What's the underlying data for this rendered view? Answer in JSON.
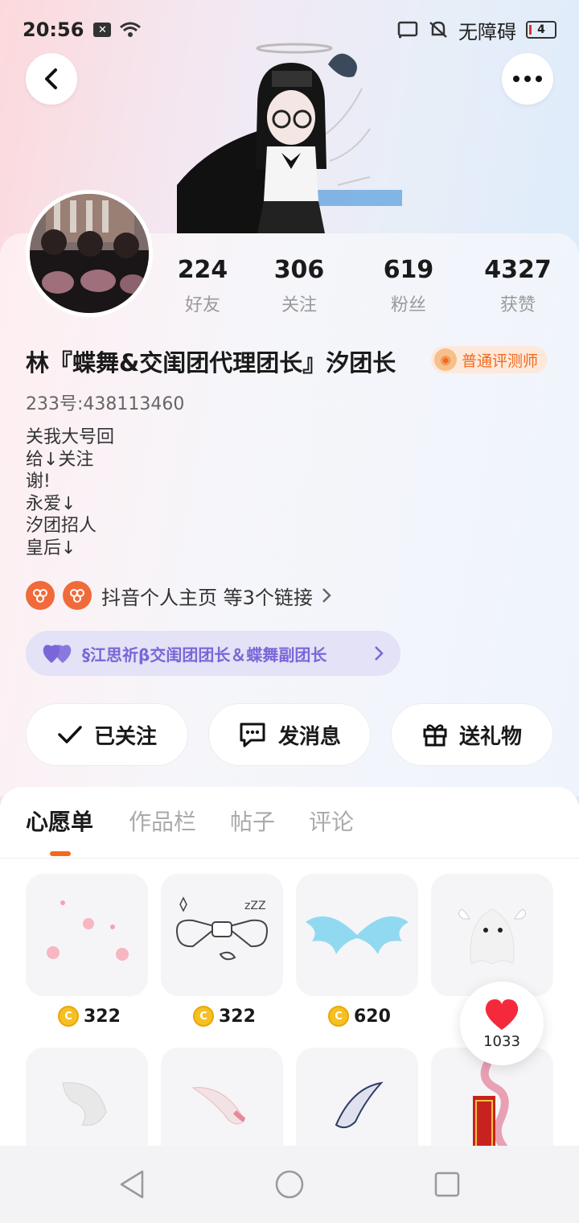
{
  "status_bar": {
    "time": "20:56",
    "accessibility": "无障碍",
    "battery": "4"
  },
  "profile": {
    "nickname": "林『蝶舞&交闺团代理团长』汐团长",
    "badge": "普通评测师",
    "uid": "233号:438113460",
    "bio_lines": [
      "关我大号回",
      "给↓关注",
      "谢!",
      "永爱↓",
      "汐团招人",
      "皇后↓"
    ],
    "links_text": "抖音个人主页 等3个链接",
    "group_text": "§江思祈β交闺团团长＆蝶舞副团长"
  },
  "stats": [
    {
      "value": "224",
      "label": "好友"
    },
    {
      "value": "306",
      "label": "关注"
    },
    {
      "value": "619",
      "label": "粉丝"
    },
    {
      "value": "4327",
      "label": "获赞"
    }
  ],
  "actions": {
    "follow": "已关注",
    "message": "发消息",
    "gift": "送礼物"
  },
  "tabs": [
    "心愿单",
    "作品栏",
    "帖子",
    "评论"
  ],
  "active_tab": "心愿单",
  "wishlist": [
    {
      "price": "322",
      "icon": "pink-sparkles-icon"
    },
    {
      "price": "322",
      "icon": "sleep-bow-icon"
    },
    {
      "price": "620",
      "icon": "blue-wings-icon"
    },
    {
      "price": "",
      "icon": "ghost-icon"
    },
    {
      "price": "",
      "icon": "white-tail-icon"
    },
    {
      "price": "",
      "icon": "pink-tail-icon"
    },
    {
      "price": "",
      "icon": "navy-tail-icon"
    },
    {
      "price": "",
      "icon": "snake-scroll-icon"
    }
  ],
  "like_count": "1033",
  "colors": {
    "accent": "#f26a1b",
    "group_purple": "#7a66d8",
    "coin": "#f6c022"
  }
}
